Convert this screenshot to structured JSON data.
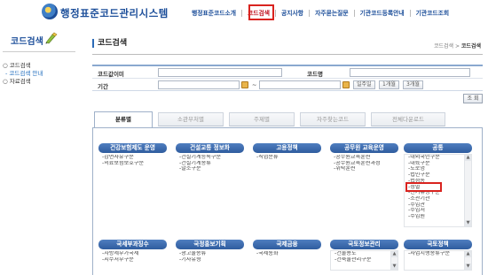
{
  "header": {
    "site_title": "행정표준코드관리시스템",
    "nav": [
      "행정표준코드소개",
      "코드검색",
      "공지사항",
      "자주묻는질문",
      "기관코드등록안내",
      "기관코드조회"
    ],
    "active_nav": "코드검색"
  },
  "sidebar": {
    "title": "코드검색",
    "items": [
      {
        "label": "○ 코드검색"
      },
      {
        "label": "- 코드검색 안내"
      },
      {
        "label": "○ 자료검색"
      }
    ]
  },
  "main": {
    "title": "코드검색",
    "breadcrumb": {
      "parent": "코드검색 >",
      "current": "코드검색"
    }
  },
  "search_form": {
    "code_value_label": "코드값이미",
    "code_name_label": "코드명",
    "period_label": "기간",
    "tilde": "~",
    "period_buttons": [
      "일주일",
      "1개월",
      "3개월"
    ],
    "search_button": "조 회"
  },
  "tabs": [
    "분류별",
    "소관부처별",
    "주제별",
    "자주찾는코드",
    "전체다운로드"
  ],
  "categories_row1": [
    {
      "title": "건강보험제도 운영",
      "items": [
        "감면사유구분",
        "의료보험보호구분"
      ]
    },
    {
      "title": "건설교통 정보화",
      "items": [
        "건설기계등록구분",
        "건설기계종류",
        "말소구분"
      ]
    },
    {
      "title": "고용정책",
      "items": [
        "직업분류"
      ]
    },
    {
      "title": "공무원 교육운영",
      "items": [
        "공무원교육훈련",
        "공무원교육훈련과정",
        "위탁훈련"
      ]
    },
    {
      "title": "공통",
      "items": [
        "내외국인구분",
        "대륙구분",
        "도로명",
        "법인구분",
        "법정동",
        "성별",
        "선거유형구분",
        "소관기관",
        "수입관",
        "수입처",
        "수입원"
      ]
    }
  ],
  "categories_row2": [
    {
      "title": "국세부과징수",
      "items": [
        "자방세부가국세",
        "지수처부구분"
      ]
    },
    {
      "title": "국정홍보기획",
      "items": [
        "광고물종류",
        "기사유형"
      ]
    },
    {
      "title": "국제금융",
      "items": [
        "국제통화"
      ]
    },
    {
      "title": "국토정보관리",
      "items": [
        "건물용도",
        "건축물관리구분"
      ]
    },
    {
      "title": "국토정책",
      "items": [
        "사업시행종류구분"
      ]
    }
  ],
  "colors": {
    "accent": "#1d4f9a",
    "category_header": "#3a68ab",
    "highlight": "#d9231f"
  },
  "icons": {
    "logo": "government-emblem-icon",
    "side": "magnifier-pen-icon",
    "calendar": "calendar-icon"
  }
}
